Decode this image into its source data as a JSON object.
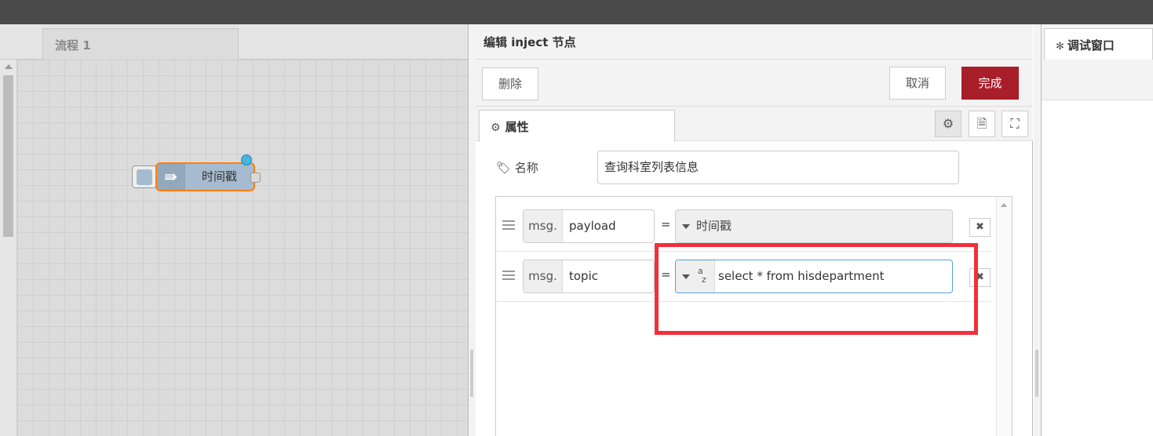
{
  "workspace": {
    "flow_tab": "流程 1",
    "node": {
      "label": "时间戳",
      "icon": "inject-arrow-icon"
    }
  },
  "editor": {
    "title": "编辑 inject 节点",
    "delete_label": "删除",
    "cancel_label": "取消",
    "done_label": "完成",
    "tab_properties": "属性",
    "name_label": "名称",
    "name_value": "查询科室列表信息",
    "rows": [
      {
        "prefix": "msg.",
        "property": "payload",
        "equals": "=",
        "type_label": "时间戳"
      },
      {
        "prefix": "msg.",
        "property": "topic",
        "equals": "=",
        "type_glyph_a": "a",
        "type_glyph_z": "z",
        "value": "select * from hisdepartment"
      }
    ]
  },
  "sidebar": {
    "debug_tab": "调试窗口"
  },
  "colors": {
    "done_button": "#a81e29",
    "highlight": "#f0303a",
    "node_fill": "#a6bbcf",
    "node_border": "#ff7f0e"
  }
}
